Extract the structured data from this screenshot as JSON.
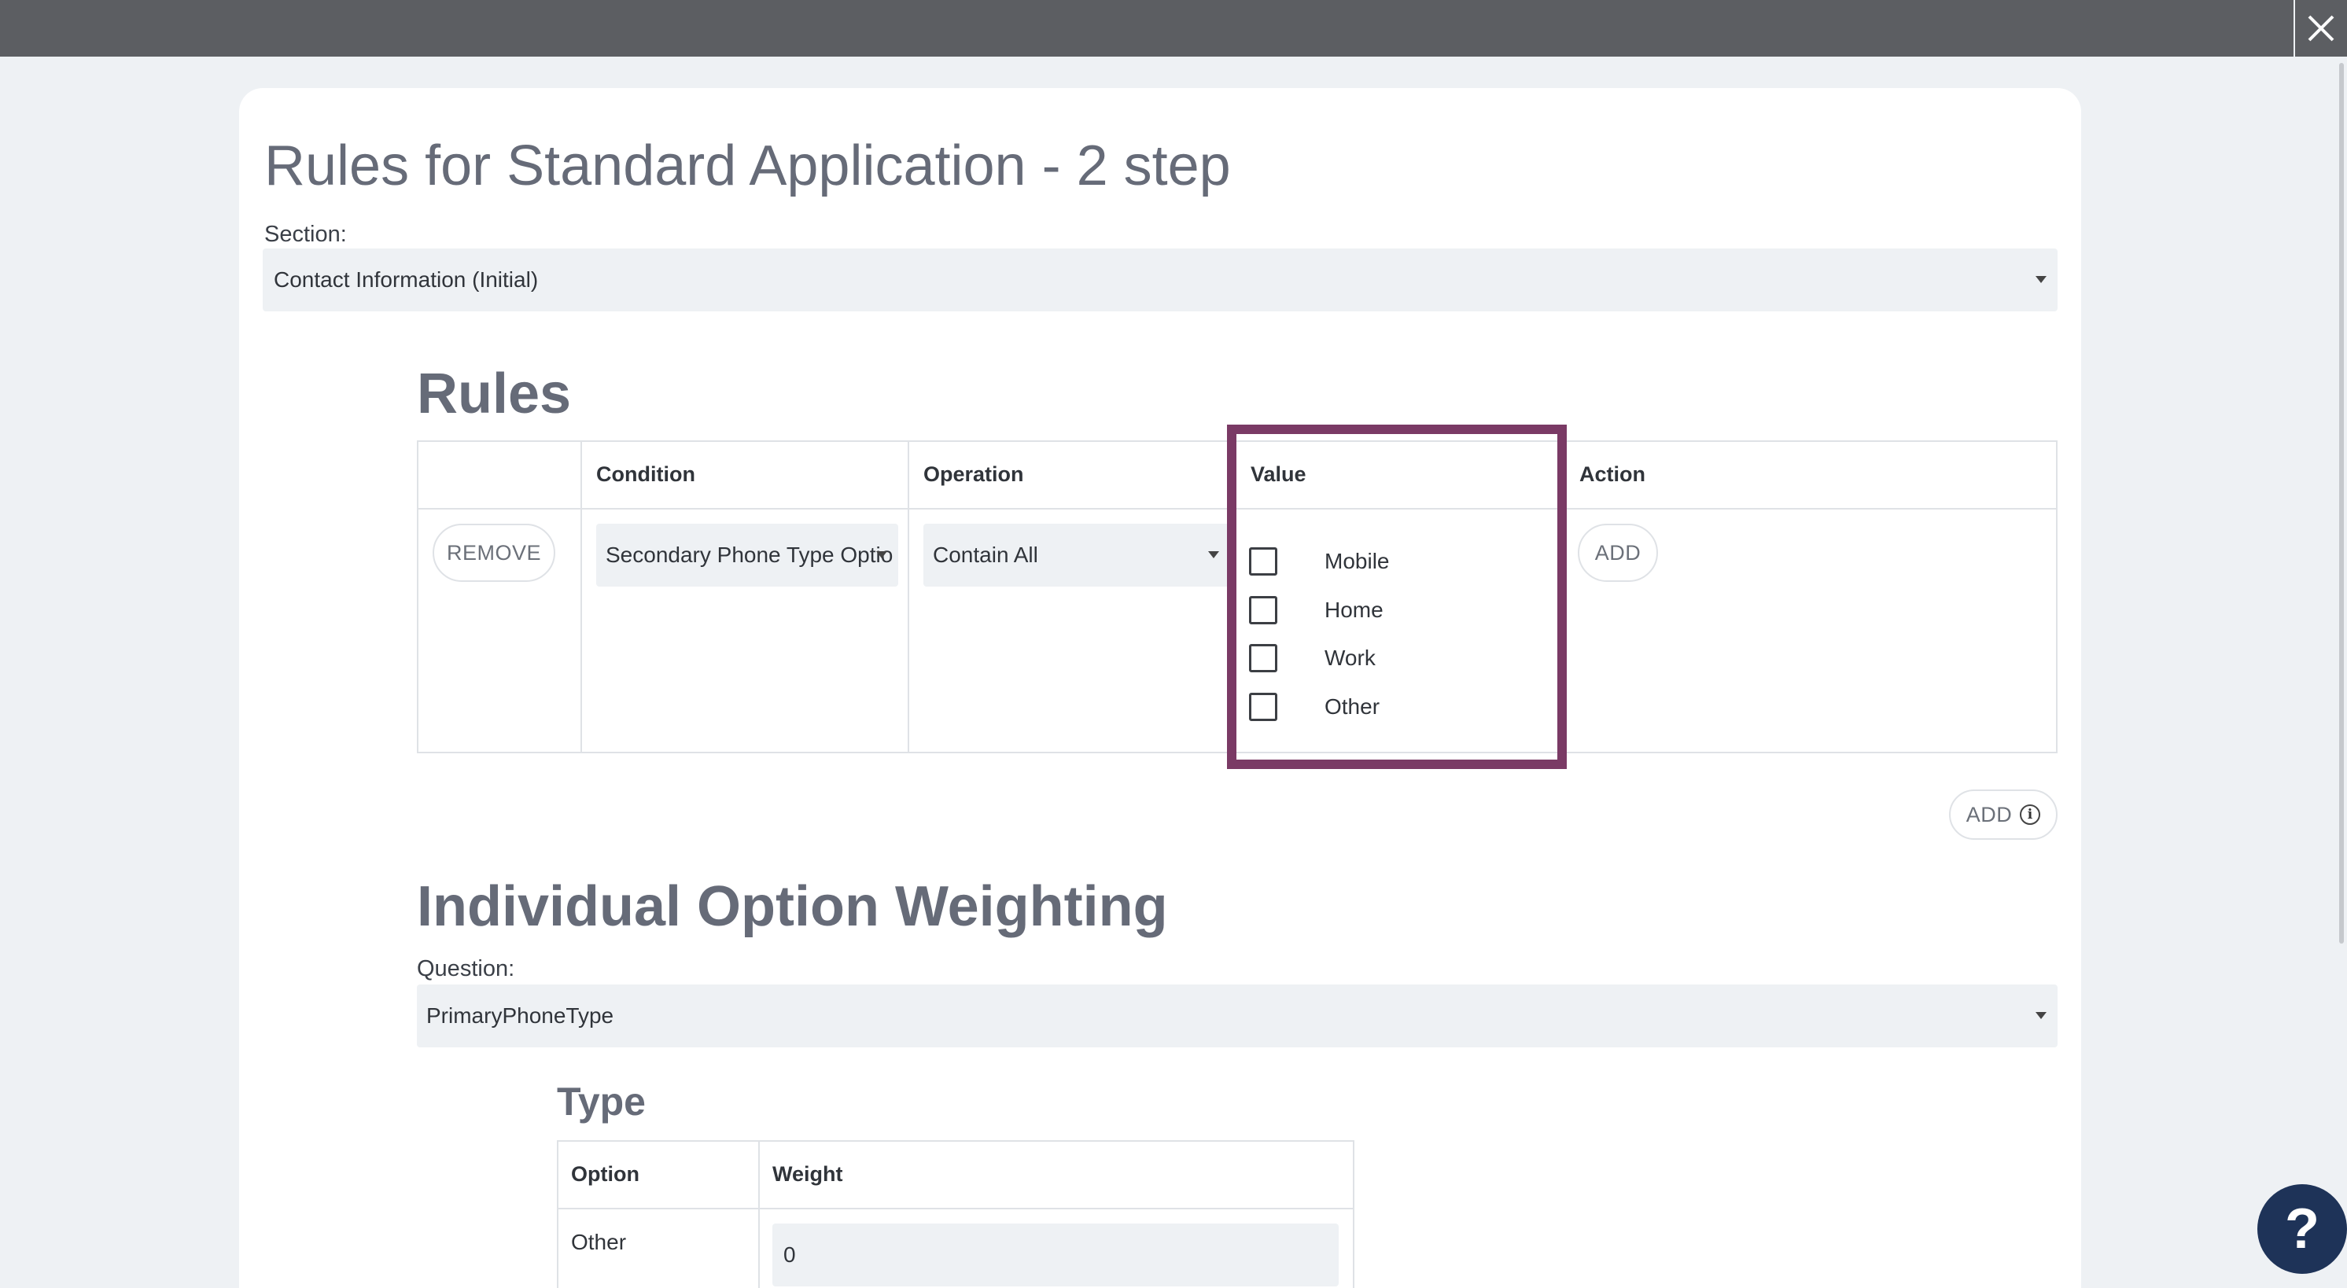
{
  "page": {
    "title": "Rules for Standard Application - 2 step",
    "section_label": "Section:",
    "section_value": "Contact Information (Initial)"
  },
  "rules": {
    "title": "Rules",
    "columns": [
      "",
      "Condition",
      "Operation",
      "Value",
      "Action"
    ],
    "row": {
      "remove_label": "REMOVE",
      "condition": "Secondary Phone Type Optio",
      "operation": "Contain All",
      "value_options": [
        {
          "label": "Mobile",
          "checked": false
        },
        {
          "label": "Home",
          "checked": false
        },
        {
          "label": "Work",
          "checked": false
        },
        {
          "label": "Other",
          "checked": false
        }
      ],
      "action_label": "ADD"
    },
    "add_label": "ADD",
    "highlight_color": "#7a3a65"
  },
  "weighting": {
    "title": "Individual Option Weighting",
    "question_label": "Question:",
    "question_value": "PrimaryPhoneType",
    "type_title": "Type",
    "columns": [
      "Option",
      "Weight"
    ],
    "rows": [
      {
        "option": "Other",
        "weight": "0"
      }
    ]
  },
  "icons": {
    "close": "close-icon",
    "info": "info-icon",
    "help": "help-icon"
  },
  "colors": {
    "topbar": "#5c5e62",
    "help_button": "#1e3358",
    "page_background": "#eef1f4"
  }
}
